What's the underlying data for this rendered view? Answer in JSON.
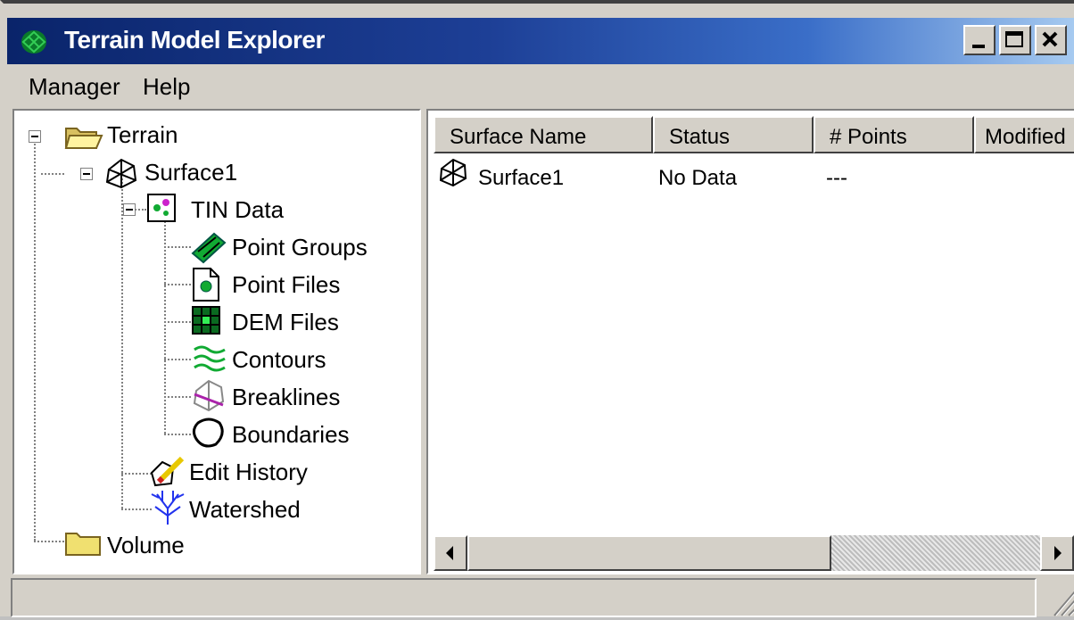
{
  "window": {
    "title": "Terrain Model Explorer"
  },
  "menu": [
    "Manager",
    "Help"
  ],
  "tree": {
    "root": "Terrain",
    "surface": "Surface1",
    "tin": "TIN Data",
    "tin_children": [
      "Point Groups",
      "Point Files",
      "DEM Files",
      "Contours",
      "Breaklines",
      "Boundaries"
    ],
    "surface_children": [
      "Edit History",
      "Watershed"
    ],
    "volume": "Volume"
  },
  "list": {
    "columns": [
      "Surface Name",
      "Status",
      "# Points",
      "Modified"
    ],
    "rows": [
      {
        "name": "Surface1",
        "status": "No Data",
        "points": "---"
      }
    ]
  },
  "colors": {
    "title_start": "#0a246a",
    "title_end": "#a6caf0",
    "face": "#d4d0c8"
  }
}
